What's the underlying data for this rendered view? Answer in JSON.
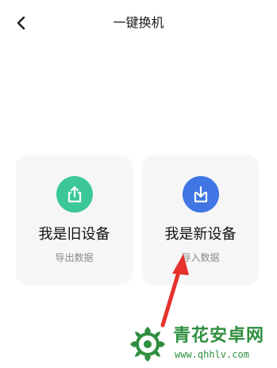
{
  "header": {
    "title": "一键换机",
    "back_icon": "back-chevron-icon"
  },
  "cards": {
    "old_device": {
      "title": "我是旧设备",
      "subtitle": "导出数据",
      "icon": "export-icon",
      "color": "#3cc79b"
    },
    "new_device": {
      "title": "我是新设备",
      "subtitle": "导入数据",
      "icon": "import-icon",
      "color": "#3f76e4"
    }
  },
  "annotation": {
    "arrow_color": "#e5322d"
  },
  "watermark": {
    "name": "青花安卓网",
    "url": "www.qhhlv.com",
    "color": "#2f8f3f"
  }
}
